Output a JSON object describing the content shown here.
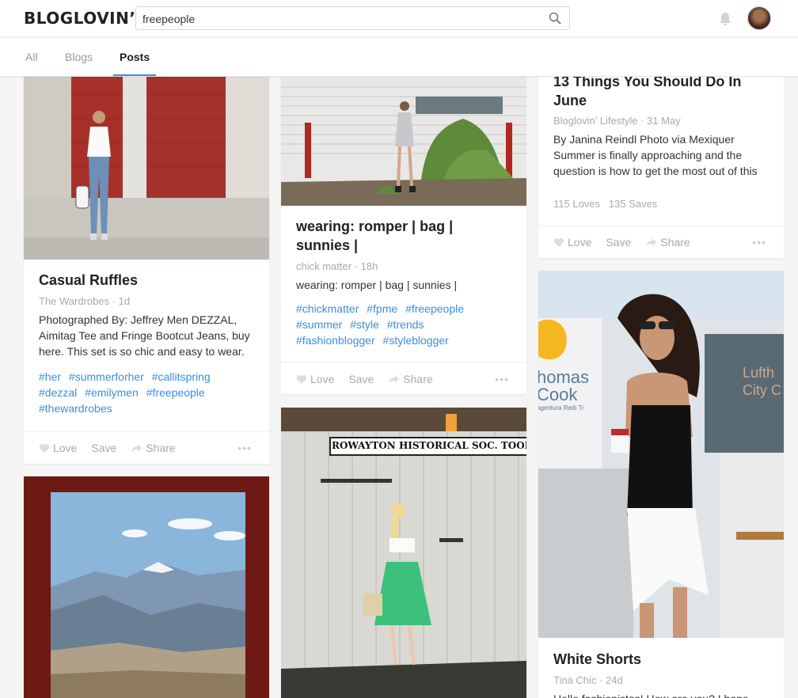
{
  "header": {
    "logo": "BLOGLOVIN’",
    "search_value": "freepeople"
  },
  "tabs": [
    {
      "label": "All"
    },
    {
      "label": "Blogs"
    },
    {
      "label": "Posts"
    }
  ],
  "actions": {
    "love": "Love",
    "save": "Save",
    "share": "Share",
    "more": "•••"
  },
  "cards": {
    "casual": {
      "title": "Casual Ruffles",
      "meta": "The Wardrobes · 1d",
      "text": "Photographed By: Jeffrey Men DEZZAL, Aimitag Tee and Fringe Bootcut Jeans, buy here. This set is so chic and easy to wear.",
      "tags": [
        "#her",
        "#summerforher",
        "#callitspring",
        "#dezzal",
        "#emilymen",
        "#freepeople",
        "#thewardrobes"
      ]
    },
    "romper": {
      "title_line1": "wearing: romper | bag |",
      "title_line2": "sunnies |",
      "meta": "chick matter · 18h",
      "text": "wearing: romper | bag | sunnies |",
      "tags": [
        "#chickmatter",
        "#fpme",
        "#freepeople",
        "#summer",
        "#style",
        "#trends",
        "#fashionblogger",
        "#styleblogger"
      ]
    },
    "june": {
      "title_line1": "13 Things You Should Do In",
      "title_line2": "June",
      "meta": "Bloglovin’ Lifestyle · 31 May",
      "text": "By Janina Reindl Photo via Mexiquer Summer is finally approaching and the question is how to get the most out of this",
      "stats": "115 Loves   135 Saves"
    },
    "historical": {
      "sign": "ROWAYTON HISTORICAL SOC. TOOL E"
    },
    "thomas": {
      "sign_line1": "homas",
      "sign_line2": "Cook",
      "sign_small": "agentura Redi Tr",
      "sign_right1": "Lufth",
      "sign_right2": "City C"
    },
    "shorts": {
      "title": "White Shorts",
      "meta": "Tina Chic · 24d",
      "text": "Hello fashionistas! How are you? I hope"
    }
  }
}
